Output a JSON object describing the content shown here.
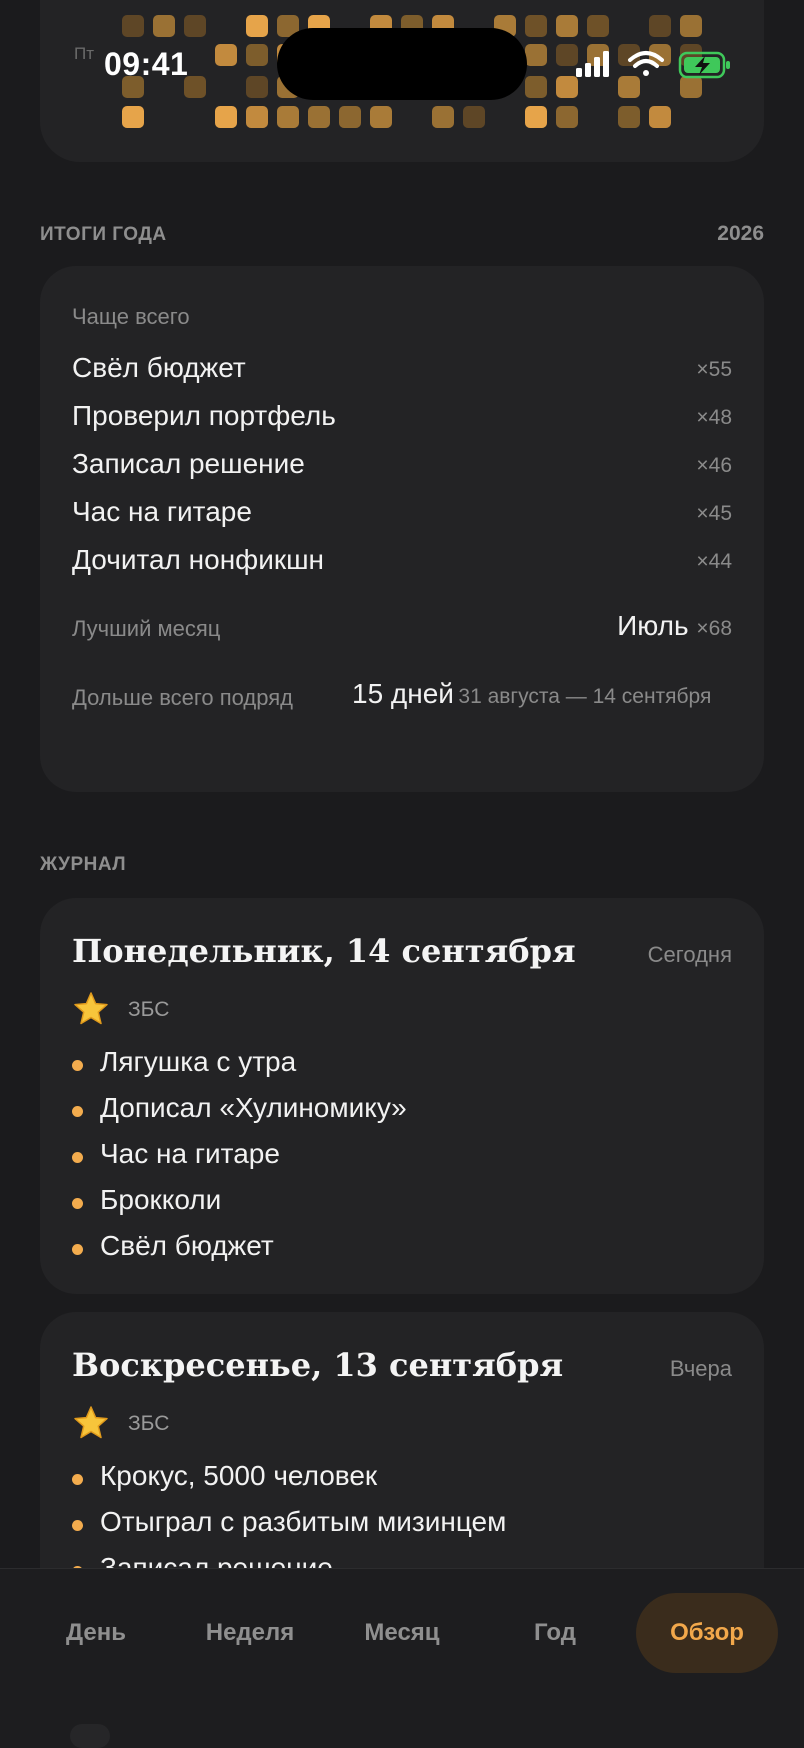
{
  "status_bar": {
    "time": "09:41",
    "icons": [
      "signal-icon",
      "wifi-icon",
      "battery-charging-icon"
    ]
  },
  "heatmap": {
    "visible_day_label": "Пт"
  },
  "year_summary": {
    "section_title": "ИТОГИ ГОДА",
    "year": "2026",
    "most_often_label": "Чаще всего",
    "items": [
      {
        "name": "Свёл бюджет",
        "count": "×55"
      },
      {
        "name": "Проверил портфель",
        "count": "×48"
      },
      {
        "name": "Записал решение",
        "count": "×46"
      },
      {
        "name": "Час на гитаре",
        "count": "×45"
      },
      {
        "name": "Дочитал нонфикшн",
        "count": "×44"
      }
    ],
    "best_month_label": "Лучший месяц",
    "best_month_value": "Июль",
    "best_month_count": "×68",
    "streak_label": "Дольше всего подряд",
    "streak_value": "15 дней",
    "streak_range": "31 августа — 14 сентября"
  },
  "journal": {
    "section_title": "ЖУРНАЛ",
    "entries": [
      {
        "title": "Понедельник, 14 сентября",
        "relative": "Сегодня",
        "rating_label": "ЗБС",
        "items": [
          "Лягушка с утра",
          "Дописал «Хулиномику»",
          "Час на гитаре",
          "Брокколи",
          "Свёл бюджет"
        ]
      },
      {
        "title": "Воскресенье, 13 сентября",
        "relative": "Вчера",
        "rating_label": "ЗБС",
        "items": [
          "Крокус, 5000 человек",
          "Отыграл с разбитым мизинцем",
          "Записал решение"
        ]
      }
    ]
  },
  "tabbar": {
    "tabs": [
      {
        "label": "День",
        "active": false
      },
      {
        "label": "Неделя",
        "active": false
      },
      {
        "label": "Месяц",
        "active": false
      },
      {
        "label": "Год",
        "active": false
      },
      {
        "label": "Обзор",
        "active": true
      }
    ],
    "accent_color": "#f2a84b"
  }
}
